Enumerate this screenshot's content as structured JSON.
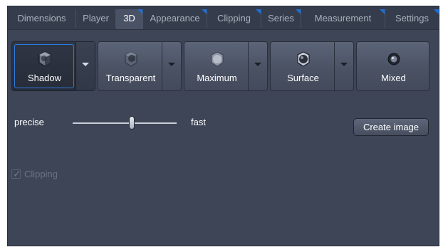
{
  "tabs": [
    {
      "label": "Dimensions",
      "active": false,
      "has_corner": false
    },
    {
      "label": "Player",
      "active": false,
      "has_corner": false
    },
    {
      "label": "3D",
      "active": true,
      "has_corner": true
    },
    {
      "label": "Appearance",
      "active": false,
      "has_corner": true
    },
    {
      "label": "Clipping",
      "active": false,
      "has_corner": true
    },
    {
      "label": "Series",
      "active": false,
      "has_corner": true
    },
    {
      "label": "Measurement",
      "active": false,
      "has_corner": true
    },
    {
      "label": "Settings",
      "active": false,
      "has_corner": true
    }
  ],
  "render_modes": [
    {
      "label": "Shadow",
      "icon": "shadow-cube-icon",
      "active": true,
      "has_dropdown": true
    },
    {
      "label": "Transparent",
      "icon": "transparent-cube-icon",
      "active": false,
      "has_dropdown": true
    },
    {
      "label": "Maximum",
      "icon": "maximum-sphere-icon",
      "active": false,
      "has_dropdown": true
    },
    {
      "label": "Surface",
      "icon": "surface-sphere-icon",
      "active": false,
      "has_dropdown": true
    },
    {
      "label": "Mixed",
      "icon": "mixed-sphere-icon",
      "active": false,
      "has_dropdown": false
    }
  ],
  "quality_slider": {
    "left_label": "precise",
    "right_label": "fast",
    "value": 0.57
  },
  "create_image_label": "Create image",
  "clipping": {
    "label": "Clipping",
    "checked": true,
    "enabled": false
  },
  "colors": {
    "panel": "#3d4556",
    "accent": "#1e6fd9"
  }
}
